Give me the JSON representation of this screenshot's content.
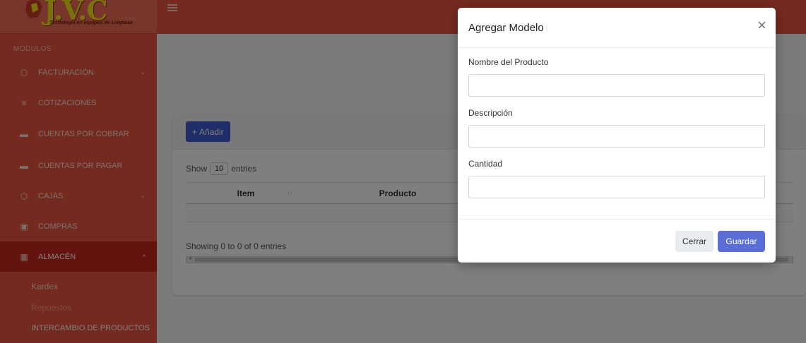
{
  "brand": {
    "logo_text": "J.V.C",
    "tagline": "Tecnología en equipos de Limpieza",
    "suffix": "S.A.C."
  },
  "sidebar": {
    "section_title": "MÓDULOS",
    "items": [
      {
        "label": "FACTURACIÓN",
        "icon": "cube-icon",
        "has_chevron": true,
        "chevron": "⌄"
      },
      {
        "label": "COTIZACIONES",
        "icon": "list-icon",
        "has_chevron": false
      },
      {
        "label": "CUENTAS POR COBRAR",
        "icon": "money-icon",
        "has_chevron": false
      },
      {
        "label": "CUENTAS POR PAGAR",
        "icon": "money-icon",
        "has_chevron": false
      },
      {
        "label": "CAJAS",
        "icon": "cube-icon",
        "has_chevron": true,
        "chevron": "⌄"
      },
      {
        "label": "COMPRAS",
        "icon": "calendar-icon",
        "has_chevron": false
      },
      {
        "label": "ALMACÉN",
        "icon": "grid-icon",
        "has_chevron": true,
        "chevron": "^",
        "active": true
      }
    ],
    "subitems": [
      {
        "label": "Kardex"
      },
      {
        "label": "Repuestos"
      },
      {
        "label": "INTERCAMBIO DE PRODUCTOS"
      }
    ]
  },
  "main": {
    "add_button_label": "Añadir",
    "show_label": "Show",
    "entries_count": "10",
    "entries_label": "entries",
    "columns": [
      "Item",
      "Producto"
    ],
    "showing_text": "Showing 0 to 0 of 0 entries"
  },
  "modal": {
    "title": "Agregar Modelo",
    "close_glyph": "×",
    "fields": [
      {
        "label": "Nombre del Producto",
        "value": ""
      },
      {
        "label": "Descripción",
        "value": ""
      },
      {
        "label": "Cantidad",
        "value": ""
      }
    ],
    "cancel_label": "Cerrar",
    "save_label": "Guardar"
  },
  "colors": {
    "sidebar": "#e8553f",
    "sidebar_active": "#c8271d",
    "primary_button": "#3f5bd1",
    "save_button": "#5b6ed6"
  }
}
